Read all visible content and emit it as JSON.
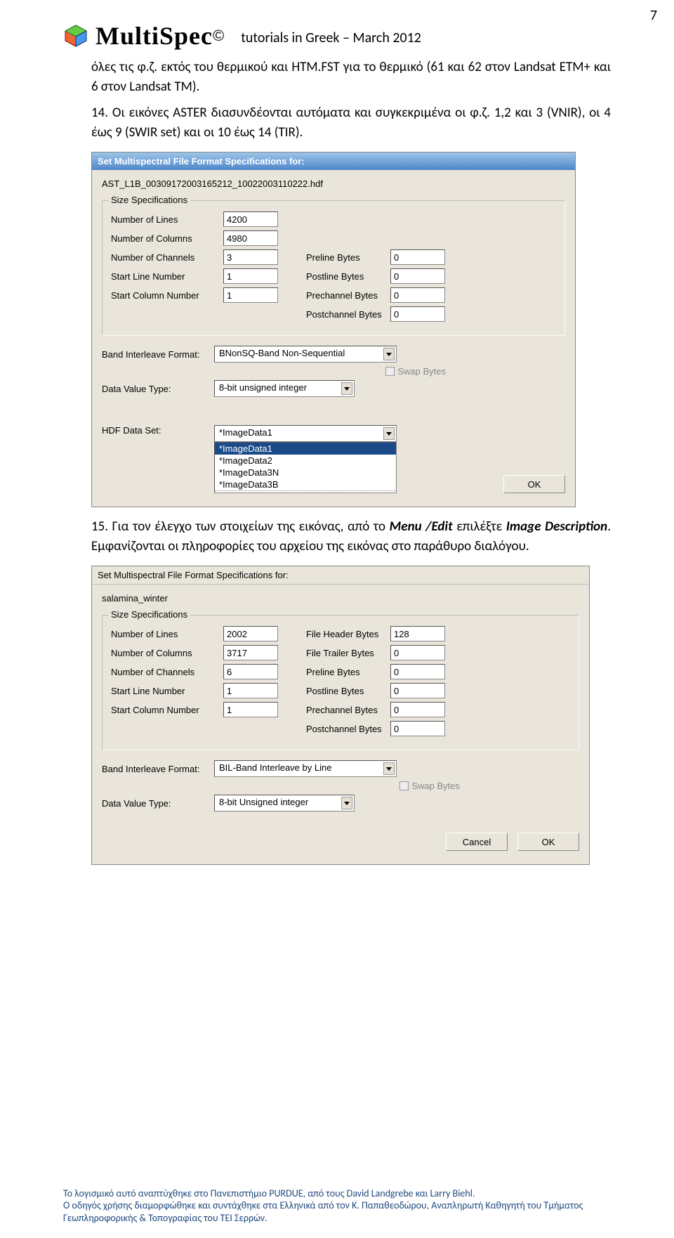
{
  "page_number": "7",
  "header_title": "tutorials in Greek – March 2012",
  "app_name": "MultiSpec",
  "copyright": "©",
  "para1": "όλες τις φ.ζ. εκτός του θερμικού  και HTM.FST για το θερμικό (61 και 62 στον Landsat ETM+ και 6 στον Landsat TM).",
  "item14_num": "14. ",
  "item14_text": "Οι εικόνες ASTER διασυνδέονται αυτόματα και συγκεκριμένα οι φ.ζ. 1,2 και 3 (VNIR), οι 4 έως 9 (SWIR set) και οι 10 έως 14 (TIR).",
  "item15_num": "15. ",
  "item15_text_a": "Για τον έλεγχο των στοιχείων της εικόνας, από το ",
  "item15_menu": "Menu /Edit",
  "item15_text_b": " επιλέξτε ",
  "item15_img": "Image Description",
  "item15_text_c": ". Εμφανίζονται οι πληροφορίες του αρχείου της εικόνας στο παράθυρο διαλόγου.",
  "dialog1": {
    "title": "Set Multispectral File Format Specifications for:",
    "filename": "AST_L1B_00309172003165212_10022003110222.hdf",
    "group": "Size Specifications",
    "lines_lbl": "Number of Lines",
    "lines": "4200",
    "cols_lbl": "Number of Columns",
    "cols": "4980",
    "chans_lbl": "Number of Channels",
    "chans": "3",
    "start_line_lbl": "Start Line Number",
    "start_line": "1",
    "start_col_lbl": "Start Column Number",
    "start_col": "1",
    "preline_lbl": "Preline Bytes",
    "preline": "0",
    "postline_lbl": "Postline Bytes",
    "postline": "0",
    "prechan_lbl": "Prechannel Bytes",
    "prechan": "0",
    "postchan_lbl": "Postchannel Bytes",
    "postchan": "0",
    "bif_lbl": "Band Interleave Format:",
    "bif": "BNonSQ-Band Non-Sequential",
    "swap_lbl": "Swap Bytes",
    "dvt_lbl": "Data Value Type:",
    "dvt": "8-bit unsigned integer",
    "hdf_lbl": "HDF Data Set:",
    "hdf": "*ImageData1",
    "list": [
      "*ImageData1",
      "*ImageData2",
      "*ImageData3N",
      "*ImageData3B"
    ],
    "ok": "OK"
  },
  "dialog2": {
    "title": "Set Multispectral File Format Specifications for:",
    "filename": "salamina_winter",
    "group": "Size Specifications",
    "lines_lbl": "Number of Lines",
    "lines": "2002",
    "cols_lbl": "Number of Columns",
    "cols": "3717",
    "chans_lbl": "Number of Channels",
    "chans": "6",
    "start_line_lbl": "Start Line Number",
    "start_line": "1",
    "start_col_lbl": "Start Column Number",
    "start_col": "1",
    "fhb_lbl": "File Header Bytes",
    "fhb": "128",
    "ftb_lbl": "File Trailer Bytes",
    "ftb": "0",
    "preline_lbl": "Preline Bytes",
    "preline": "0",
    "postline_lbl": "Postline Bytes",
    "postline": "0",
    "prechan_lbl": "Prechannel Bytes",
    "prechan": "0",
    "postchan_lbl": "Postchannel Bytes",
    "postchan": "0",
    "bif_lbl": "Band Interleave Format:",
    "bif": "BIL-Band Interleave by Line",
    "swap_lbl": "Swap Bytes",
    "dvt_lbl": "Data Value Type:",
    "dvt": "8-bit Unsigned integer",
    "cancel": "Cancel",
    "ok": "OK"
  },
  "footer1": "Το λογισμικό αυτό αναπτύχθηκε στο Πανεπιστήμιο PURDUE, από τους David Landgrebe και Larry Biehl.",
  "footer2": "Ο οδηγός χρήσης διαμορφώθηκε και συντάχθηκε στα Ελληνικά από τον Κ. Παπαθεοδώρου, Αναπληρωτή Καθηγητή του Τμήματος Γεωπληροφορικής & Τοπογραφίας του ΤΕΙ Σερρών."
}
